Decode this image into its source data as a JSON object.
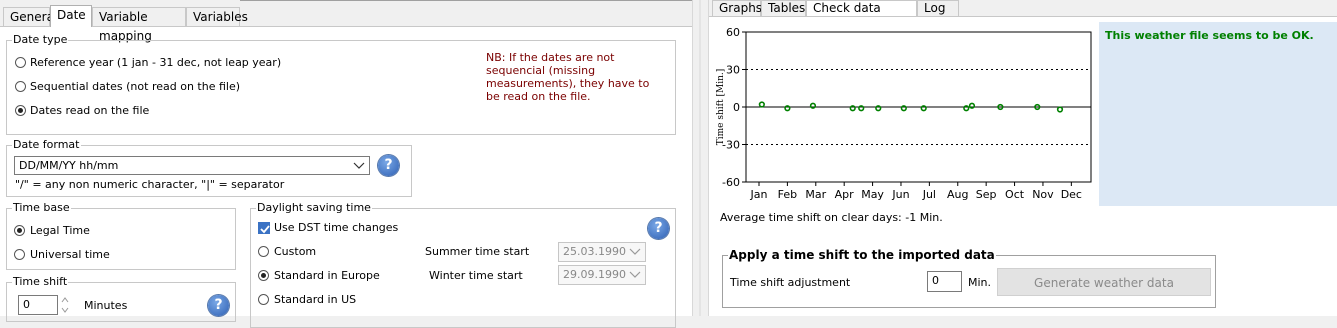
{
  "left": {
    "tabs": [
      "General",
      "Date",
      "Variable mapping",
      "Variables"
    ],
    "active_tab": "Date",
    "date_type": {
      "legend": "Date type",
      "options": [
        "Reference year (1 jan - 31 dec, not leap year)",
        "Sequential dates (not read on the file)",
        "Dates read on the file"
      ],
      "selected": 2,
      "note": "NB: If the dates are not sequencial (missing measurements), they have to be read on the file."
    },
    "date_format": {
      "legend": "Date format",
      "value": "DD/MM/YY hh/mm",
      "hint": "\"/\" = any non numeric character, \"|\" = separator",
      "help_icon": "help-icon"
    },
    "time_base": {
      "legend": "Time base",
      "options": [
        "Legal Time",
        "Universal time"
      ],
      "selected": 0
    },
    "time_shift": {
      "legend": "Time shift",
      "value": "0",
      "unit": "Minutes"
    },
    "dst": {
      "legend": "Daylight saving time",
      "use_dst_label": "Use DST time changes",
      "use_dst_checked": true,
      "options": [
        "Custom",
        "Standard in Europe",
        "Standard in US"
      ],
      "selected": 1,
      "summer_label": "Summer time start",
      "summer_value": "25.03.1990",
      "winter_label": "Winter time start",
      "winter_value": "29.09.1990"
    }
  },
  "right": {
    "tabs": [
      "Graphs",
      "Tables",
      "Check data quality",
      "Log"
    ],
    "active_tab": "Check data quality",
    "status_message": "This weather file seems to be OK.",
    "status_color": "#008000",
    "average_shift": "Average time shift on clear days: -1 Min.",
    "apply_shift": {
      "legend": "Apply a time shift to the imported data",
      "label": "Time shift adjustment",
      "value": "0",
      "unit": "Min.",
      "button": "Generate weather data"
    }
  },
  "chart_data": {
    "type": "scatter",
    "ylabel": "Time shift [Min.]",
    "ylim": [
      -60,
      60
    ],
    "yticks": [
      "60",
      "30",
      "0",
      "-30",
      "-60"
    ],
    "categories": [
      "Jan",
      "Feb",
      "Mar",
      "Apr",
      "May",
      "Jun",
      "Jul",
      "Aug",
      "Sep",
      "Oct",
      "Nov",
      "Dec"
    ],
    "x_month": [
      0.1,
      1.0,
      1.9,
      3.3,
      3.6,
      4.2,
      5.1,
      5.8,
      7.3,
      7.5,
      8.5,
      9.8,
      10.6
    ],
    "values": [
      2,
      -1,
      1,
      -1,
      -1,
      -1,
      -1,
      -1,
      -1,
      1,
      0,
      0,
      -2
    ],
    "dotted_lines": [
      30,
      -30
    ],
    "zero_line": 0,
    "marker_color": "#008000"
  }
}
